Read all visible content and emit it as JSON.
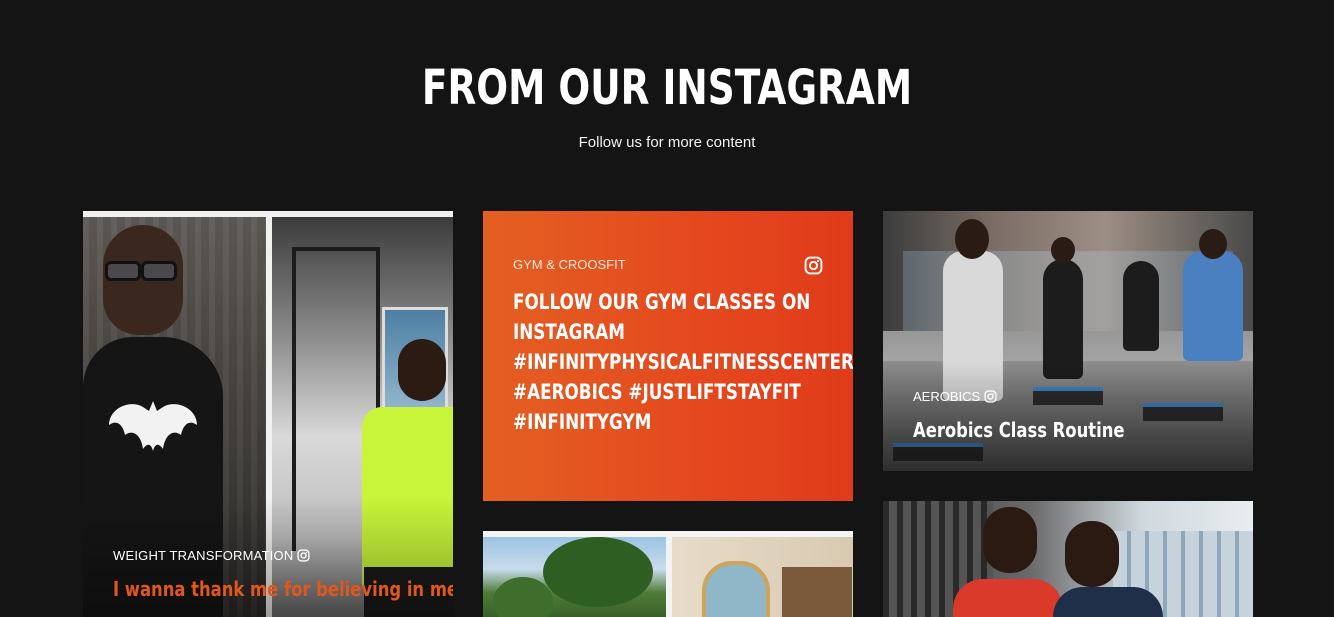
{
  "section": {
    "title": "FROM OUR INSTAGRAM",
    "subtitle": "Follow us for more content"
  },
  "posts": [
    {
      "category": "WEIGHT TRANSFORMATION",
      "caption": "I wanna thank me for believing in me",
      "icon": "instagram-icon"
    },
    {
      "category": "GYM & CROOSFIT",
      "caption": "FOLLOW OUR GYM CLASSES ON INSTAGRAM #INFINITYPHYSICALFITNESSCENTER #AEROBICS #JUSTLIFTSTAYFIT #INFINITYGYM",
      "icon": "instagram-icon"
    },
    {
      "category": "AEROBICS",
      "caption": "Aerobics Class Routine",
      "icon": "instagram-icon"
    }
  ],
  "colors": {
    "background": "#141414",
    "accent": "#e4481e",
    "accent_text": "#e2571c"
  }
}
